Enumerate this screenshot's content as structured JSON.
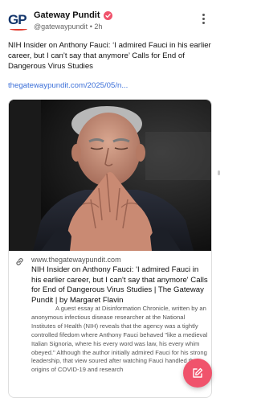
{
  "post": {
    "author": {
      "name": "Gateway Pundit",
      "handle": "@gatewaypundit",
      "time": "2h",
      "avatar_letters": "GP"
    },
    "text": "NIH Insider on Anthony Fauci: ‘I admired Fauci in his earlier career, but I can’t say that anymore’ Calls for End of Dangerous Virus Studies",
    "link": "thegatewaypundit.com/2025/05/n...",
    "card": {
      "image_alt": "Photo of Anthony Fauci with hands clasped",
      "domain": "www.thegatewaypundit.com",
      "title": "NIH Insider on Anthony Fauci: 'I admired Fauci in his earlier career, but I can't say that anymore' Calls for End of Dangerous Virus Studies | The Gateway Pundit | by Margaret Flavin",
      "description": "A guest essay at Disinformation Chronicle, written by an anonymous infectious disease researcher at the National Institutes of Health (NIH) reveals that the agency was a tightly controlled fifedom where Anthony Fauci behaved \"like a medieval Italian Signoria, where his every word was law, his every whim obeyed.\" Although the author initially admired Fauci for his strong leadership, that view soured after watching Fauci handled the origins of COVID-19 and research"
    }
  },
  "colors": {
    "brand_navy": "#13356b",
    "brand_red": "#e23b2e",
    "verified_pink": "#f0536c",
    "link_blue": "#3b6fd8",
    "fab_pink": "#f0536c"
  },
  "icons": {
    "verified": "verified-badge-icon",
    "menu": "more-vertical-icon",
    "link": "link-icon",
    "compose": "compose-icon"
  }
}
